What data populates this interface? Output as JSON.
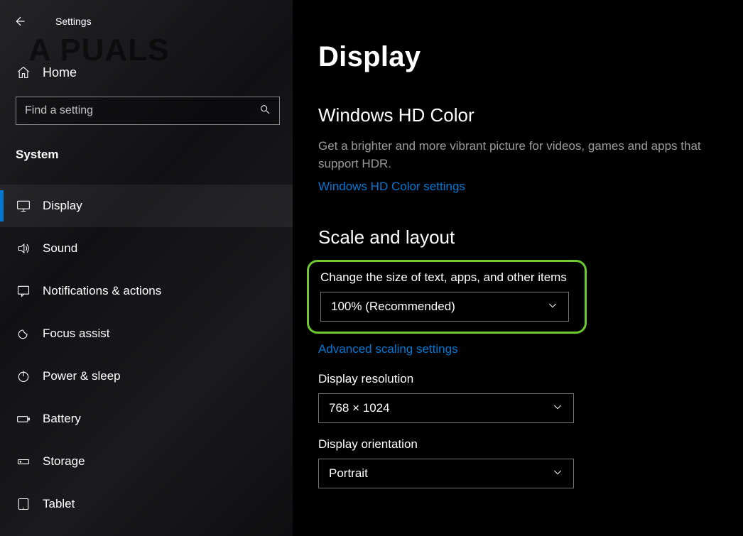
{
  "header": {
    "settings_label": "Settings",
    "home_label": "Home",
    "search_placeholder": "Find a setting",
    "section_label": "System"
  },
  "sidebar": {
    "items": [
      {
        "key": "display",
        "label": "Display",
        "active": true
      },
      {
        "key": "sound",
        "label": "Sound"
      },
      {
        "key": "notifications",
        "label": "Notifications & actions"
      },
      {
        "key": "focus-assist",
        "label": "Focus assist"
      },
      {
        "key": "power-sleep",
        "label": "Power & sleep"
      },
      {
        "key": "battery",
        "label": "Battery"
      },
      {
        "key": "storage",
        "label": "Storage"
      },
      {
        "key": "tablet",
        "label": "Tablet"
      }
    ]
  },
  "main": {
    "title": "Display",
    "hd_color": {
      "heading": "Windows HD Color",
      "description": "Get a brighter and more vibrant picture for videos, games and apps that support HDR.",
      "link": "Windows HD Color settings"
    },
    "scale_layout": {
      "heading": "Scale and layout",
      "scale_label": "Change the size of text, apps, and other items",
      "scale_value": "100% (Recommended)",
      "advanced_link": "Advanced scaling settings",
      "resolution_label": "Display resolution",
      "resolution_value": "768 × 1024",
      "orientation_label": "Display orientation",
      "orientation_value": "Portrait"
    }
  },
  "highlight_color": "#6eca2f",
  "accent_color": "#0078D4",
  "watermark": "A   PUALS"
}
